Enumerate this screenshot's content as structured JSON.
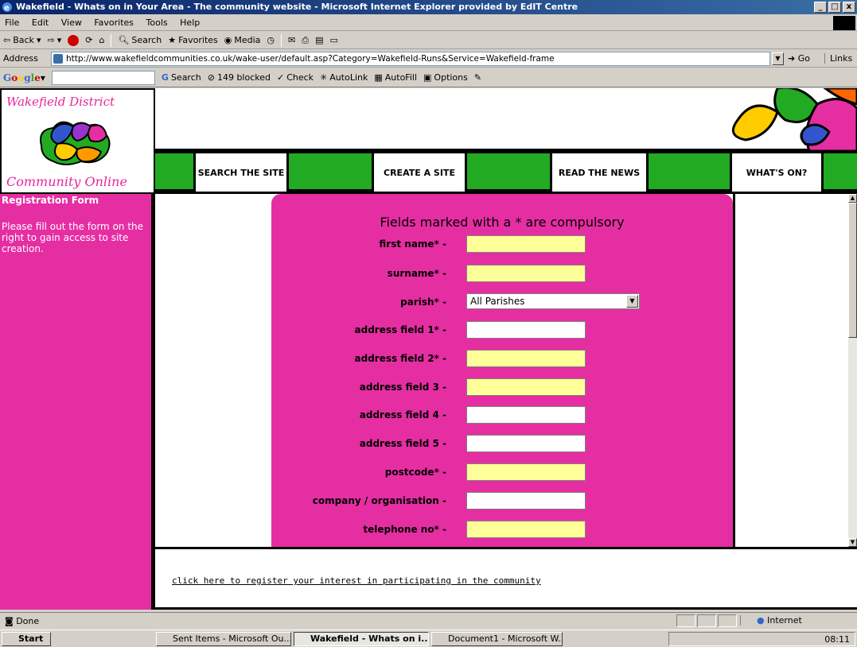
{
  "window": {
    "title": "Wakefield - Whats on in Your Area - The community website - Microsoft Internet Explorer provided by EdIT Centre",
    "buttons": [
      "_",
      "□",
      "x"
    ]
  },
  "menu": [
    "File",
    "Edit",
    "View",
    "Favorites",
    "Tools",
    "Help"
  ],
  "toolbar": {
    "back": "Back",
    "search": "Search",
    "favorites": "Favorites",
    "media": "Media"
  },
  "address": {
    "label": "Address",
    "url": "http://www.wakefieldcommunities.co.uk/wake-user/default.asp?Category=Wakefield-Runs&Service=Wakefield-frame",
    "go": "Go",
    "links": "Links"
  },
  "googlebar": {
    "logo": "Google",
    "search": "Search",
    "blocked": "149 blocked",
    "check": "Check",
    "autolink": "AutoLink",
    "autofill": "AutoFill",
    "options": "Options"
  },
  "site": {
    "logo_top": "Wakefield District",
    "logo_bottom": "Community Online",
    "nav": [
      "SEARCH THE SITE",
      "CREATE A SITE",
      "READ THE NEWS",
      "WHAT'S ON?"
    ],
    "sidebar_title": "Registration Form",
    "sidebar_text": "Please fill out the form on the right to gain access to site creation.",
    "form_heading": "Fields marked with a * are compulsory",
    "fields": [
      {
        "label": "first name* -",
        "value": ""
      },
      {
        "label": "surname* -",
        "value": ""
      },
      {
        "label": "parish* -",
        "value": "All Parishes"
      },
      {
        "label": "address field 1* -",
        "value": ""
      },
      {
        "label": "address field 2* -",
        "value": ""
      },
      {
        "label": "address field 3 -",
        "value": ""
      },
      {
        "label": "address field 4 -",
        "value": ""
      },
      {
        "label": "address field 5 -",
        "value": ""
      },
      {
        "label": "postcode* -",
        "value": ""
      },
      {
        "label": "company / organisation -",
        "value": ""
      },
      {
        "label": "telephone no* -",
        "value": ""
      }
    ],
    "bottom_link": "click here to register your interest in participating in the community"
  },
  "status": {
    "text": "Done",
    "zone": "Internet"
  },
  "taskbar": {
    "start": "Start",
    "tasks": [
      "Sent Items - Microsoft Ou...",
      "Wakefield - Whats on i...",
      "Document1 - Microsoft W..."
    ],
    "clock": "08:11"
  },
  "colors": {
    "brand_pink": "#e62ea3",
    "nav_green": "#22aa22",
    "required_yellow": "#ffff99"
  }
}
